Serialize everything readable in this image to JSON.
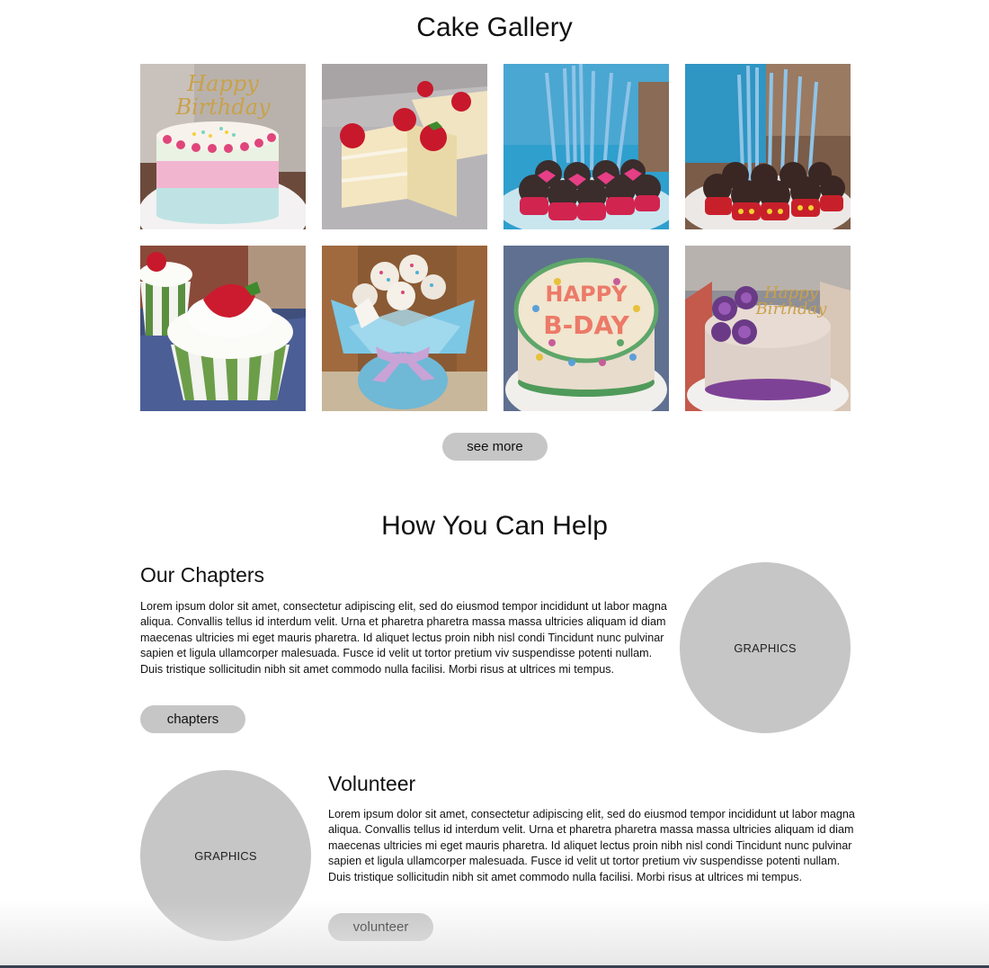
{
  "gallery": {
    "title": "Cake Gallery",
    "images": [
      {
        "name": "happy-birthday-layer-cake"
      },
      {
        "name": "strawberry-shortcake-slices"
      },
      {
        "name": "minnie-mouse-cake-pops"
      },
      {
        "name": "mickey-mouse-cake-pops"
      },
      {
        "name": "strawberry-cupcake"
      },
      {
        "name": "cake-pop-bouquet"
      },
      {
        "name": "happy-bday-polka-dot-cake"
      },
      {
        "name": "purple-rose-birthday-cake"
      }
    ],
    "see_more_label": "see more"
  },
  "help": {
    "title": "How You Can Help",
    "chapters": {
      "title": "Our Chapters",
      "text": "Lorem ipsum dolor sit amet, consectetur adipiscing elit, sed do eiusmod tempor incididunt ut labor magna aliqua. Convallis tellus id interdum velit. Urna et pharetra pharetra massa massa ultricies aliquam id diam maecenas ultricies mi eget mauris pharetra. Id aliquet lectus proin nibh nisl condi Tincidunt nunc pulvinar sapien et ligula ullamcorper malesuada. Fusce id velit ut tortor pretium viv suspendisse potenti nullam. Duis tristique sollicitudin nibh sit amet commodo nulla facilisi. Morbi risus at ultrices mi tempus.",
      "button_label": "chapters",
      "graphic_label": "GRAPHICS"
    },
    "volunteer": {
      "title": "Volunteer",
      "text": "Lorem ipsum dolor sit amet, consectetur adipiscing elit, sed do eiusmod tempor incididunt ut labor magna aliqua. Convallis tellus id interdum velit. Urna et pharetra pharetra massa massa ultricies aliquam id diam maecenas ultricies mi eget mauris pharetra. Id aliquet lectus proin nibh nisl condi Tincidunt nunc pulvinar sapien et ligula ullamcorper malesuada. Fusce id velit ut tortor pretium viv suspendisse potenti nullam. Duis tristique sollicitudin nibh sit amet commodo nulla facilisi. Morbi risus at ultrices mi tempus.",
      "button_label": "volunteer",
      "graphic_label": "GRAPHICS"
    }
  }
}
